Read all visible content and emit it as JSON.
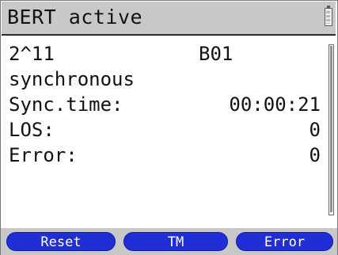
{
  "header": {
    "title": "BERT active",
    "battery_icon": "battery-icon"
  },
  "content": {
    "pattern": "2^11",
    "channel": "B01",
    "status": "synchronous",
    "sync_time_label": "Sync.time:",
    "sync_time_value": "00:00:21",
    "los_label": "LOS:",
    "los_value": "0",
    "error_label": "Error:",
    "error_value": "0"
  },
  "softkeys": {
    "reset": "Reset",
    "tm": "TM",
    "error": "Error"
  },
  "colors": {
    "softkey_blue": "#1f2fd5",
    "bar_gray": "#c8c8c8"
  }
}
